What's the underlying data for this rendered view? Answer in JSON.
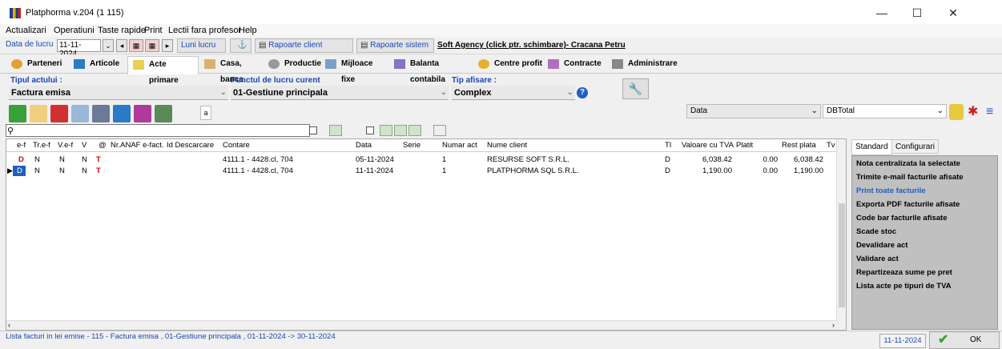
{
  "window": {
    "title": "Platphorma v.204  (1 115)",
    "controls": {
      "minimize": "—",
      "maximize": "☐",
      "close": "✕"
    }
  },
  "menu": [
    "Actualizari",
    "Operatiuni",
    "Taste rapide",
    "Print",
    "Lectii fara profesor",
    "Help"
  ],
  "toolbar": {
    "date_label": "Data de lucru",
    "date_value": "11-11-2024",
    "luni_lucru": "Luni lucru",
    "rapoarte_client": "Rapoarte client",
    "rapoarte_sistem": "Rapoarte sistem",
    "company": "Soft Agency (click ptr. schimbare)- Cracana Petru"
  },
  "tabs": [
    "Parteneri",
    "Articole",
    "Acte primare",
    "Casa, banca",
    "Productie",
    "Mijloace fixe",
    "Balanta contabila",
    "Centre profit",
    "Contracte",
    "Administrare"
  ],
  "filters": {
    "tip_actului_label": "Tipul actului :",
    "tip_actului_value": "Factura emisa",
    "punct_label": "Punctul de lucru curent",
    "punct_value": "01-Gestiune principala",
    "tip_afisare_label": "Tip afisare :",
    "tip_afisare_value": "Complex",
    "help": "?"
  },
  "actions": {
    "a_label": "a",
    "data_select": "Data",
    "dbtotal_select": "DBTotal"
  },
  "grid": {
    "columns": [
      "e-f",
      "Tr.e-f",
      "V.e-f",
      "V",
      "@",
      "Nr.ANAF e-fact.",
      "Id Descarcare",
      "Contare",
      "Data",
      "Serie",
      "Numar act",
      "Nume client",
      "TI",
      "Valoare cu TVA",
      "Platit",
      "Rest plata",
      "Tv"
    ],
    "rows": [
      {
        "ef": "D",
        "tref": "N",
        "vef": "N",
        "v": "N",
        "at": "T",
        "nr_anaf": "",
        "id_desc": "",
        "contare": "4111.1 - 4428.cl, 704",
        "data": "05-11-2024",
        "serie": "",
        "numar": "1",
        "client": "RESURSE SOFT S.R.L.",
        "ti": "D",
        "valoare": "6,038.42",
        "platit": "0.00",
        "rest": "6,038.42"
      },
      {
        "ef": "D",
        "tref": "N",
        "vef": "N",
        "v": "N",
        "at": "T",
        "nr_anaf": "",
        "id_desc": "",
        "contare": "4111.1 - 4428.cl, 704",
        "data": "11-11-2024",
        "serie": "",
        "numar": "1",
        "client": "PLATPHORMA SQL S.R.L.",
        "ti": "D",
        "valoare": "1,190.00",
        "platit": "0.00",
        "rest": "1,190.00"
      }
    ]
  },
  "side_panel": {
    "tabs": [
      "Standard",
      "Configurari"
    ],
    "items": [
      "Nota centralizata la selectate",
      "Trimite e-mail facturile afisate",
      "Print toate facturile",
      "Exporta PDF facturile afisate",
      "Code bar facturile afisate",
      "Scade stoc",
      "Devalidare act",
      "Validare act",
      "Repartizeaza sume pe pret",
      "Lista acte pe tipuri de TVA"
    ]
  },
  "status": {
    "text": "Lista facturi in lei emise - 115 - Factura emisa , 01-Gestiune principala , 01-11-2024 -> 30-11-2024",
    "date": "11-11-2024",
    "ok": "OK"
  }
}
